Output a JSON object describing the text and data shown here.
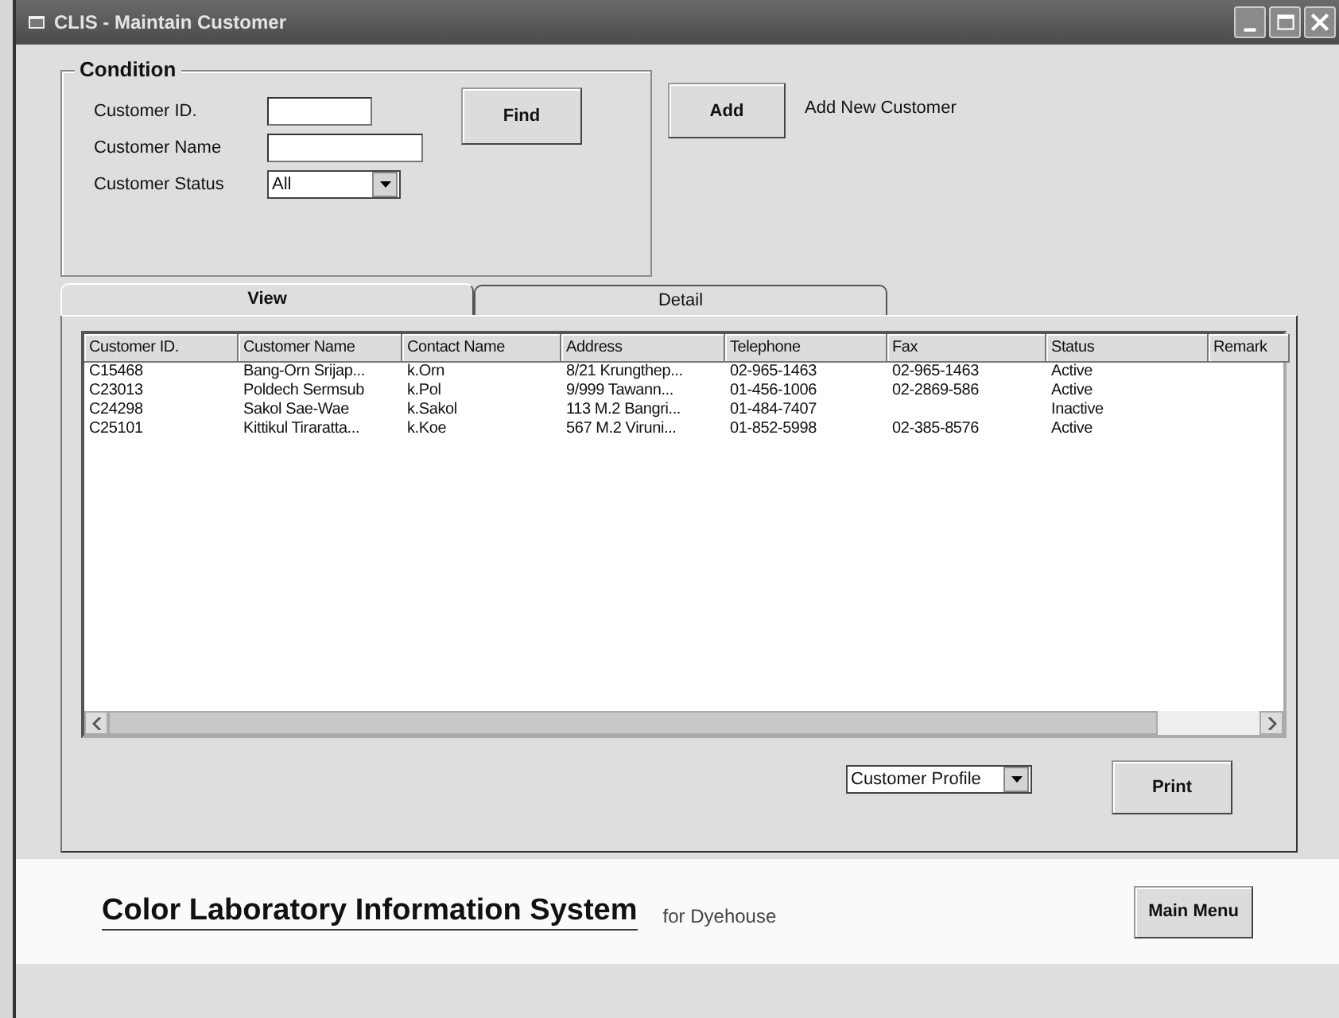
{
  "window": {
    "title": "CLIS - Maintain Customer"
  },
  "condition": {
    "title": "Condition",
    "fields": [
      {
        "label": "Customer ID.",
        "kind": "text"
      },
      {
        "label": "Customer Name",
        "kind": "text"
      },
      {
        "label": "Customer Status",
        "kind": "select",
        "value": "All"
      }
    ],
    "find_button": "Find"
  },
  "add_button": "Add",
  "add_hint": "Add New Customer",
  "tabs": [
    {
      "label": "View",
      "selected": true
    },
    {
      "label": "Detail",
      "selected": false
    }
  ],
  "table": {
    "columns": [
      "Customer ID.",
      "Customer Name",
      "Contact Name",
      "Address",
      "Telephone",
      "Fax",
      "Status",
      "Remark"
    ],
    "rows": [
      [
        "C15468",
        "Bang-Orn Srijap...",
        "k.Orn",
        "8/21 Krungthep...",
        "02-965-1463",
        "02-965-1463",
        "Active"
      ],
      [
        "C23013",
        "Poldech Sermsub",
        "k.Pol",
        "9/999 Tawann...",
        "01-456-1006",
        "02-2869-586",
        "Active"
      ],
      [
        "C24298",
        "Sakol Sae-Wae",
        "k.Sakol",
        "113 M.2 Bangri...",
        "01-484-7407",
        null,
        "Inactive"
      ],
      [
        "C25101",
        "Kittikul Tiraratta...",
        "k.Koe",
        "567 M.2 Viruni...",
        "01-852-5998",
        "02-385-8576",
        "Active"
      ]
    ]
  },
  "report_select": {
    "value": "Customer Profile"
  },
  "print_button": "Print",
  "footer": {
    "title": "Color Laboratory Information System",
    "subtitle": "for Dyehouse",
    "main_menu_button": "Main Menu"
  }
}
